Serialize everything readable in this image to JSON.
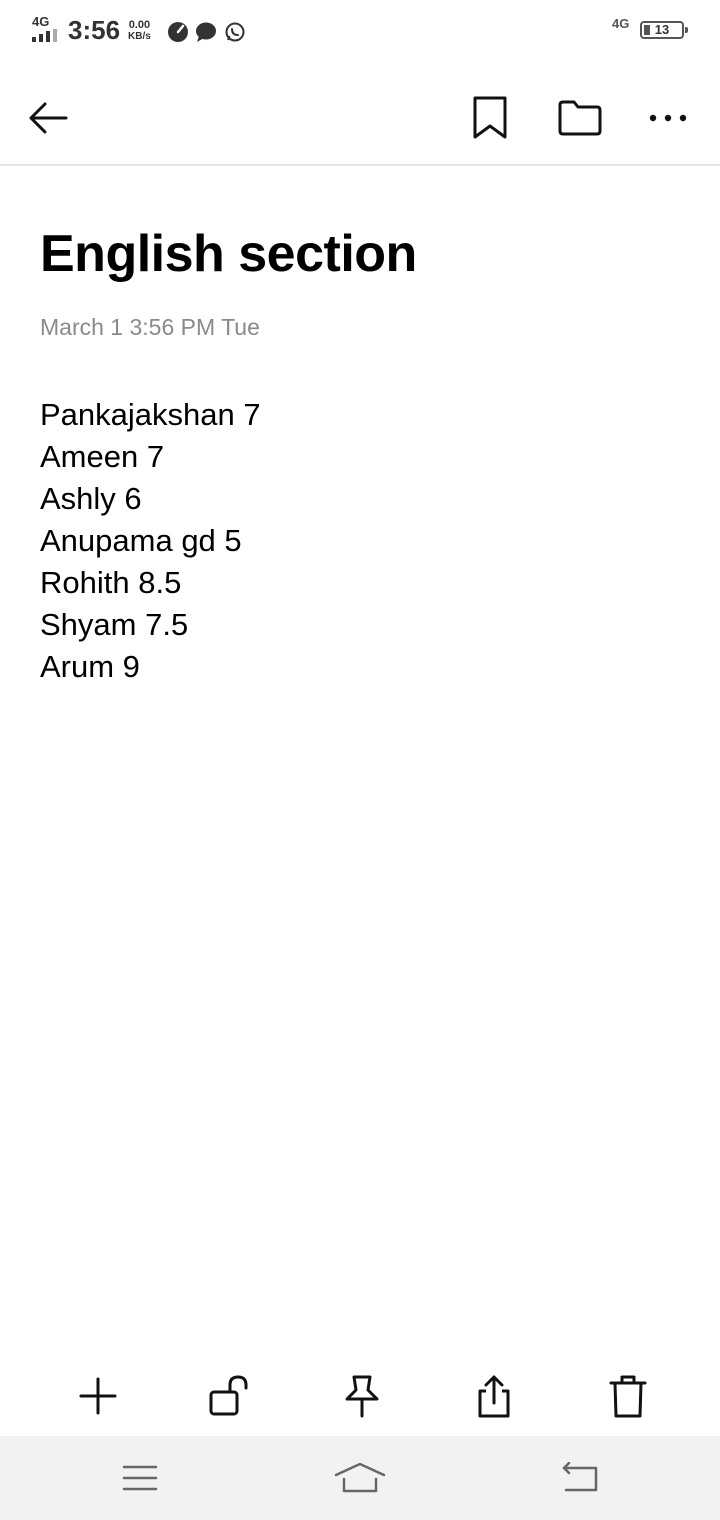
{
  "status_bar": {
    "network_left": "4G",
    "time": "3:56",
    "speed_value": "0.00",
    "speed_unit": "KB/s",
    "network_right": "4G",
    "battery": "13",
    "icons": [
      "speedometer-icon",
      "chat-bubble-icon",
      "whatsapp-icon"
    ]
  },
  "toolbar": {
    "icons": [
      "back-arrow-icon",
      "bookmark-icon",
      "folder-icon",
      "more-options-icon"
    ]
  },
  "note": {
    "title": "English section",
    "date": "March 1 3:56 PM Tue",
    "lines": [
      "Pankajakshan 7",
      "Ameen 7",
      "Ashly 6",
      "Anupama gd 5",
      "Rohith 8.5",
      "Shyam 7.5",
      "Arum 9"
    ]
  },
  "action_bar": {
    "icons": [
      "add-icon",
      "unlock-icon",
      "pin-icon",
      "share-icon",
      "delete-icon"
    ]
  },
  "system_nav": {
    "icons": [
      "menu-icon",
      "home-icon",
      "back-icon"
    ]
  },
  "colors": {
    "text": "#000000",
    "date_gray": "#8a8a8a",
    "divider": "#e6e6e6",
    "nav_bg": "#f2f2f2"
  }
}
